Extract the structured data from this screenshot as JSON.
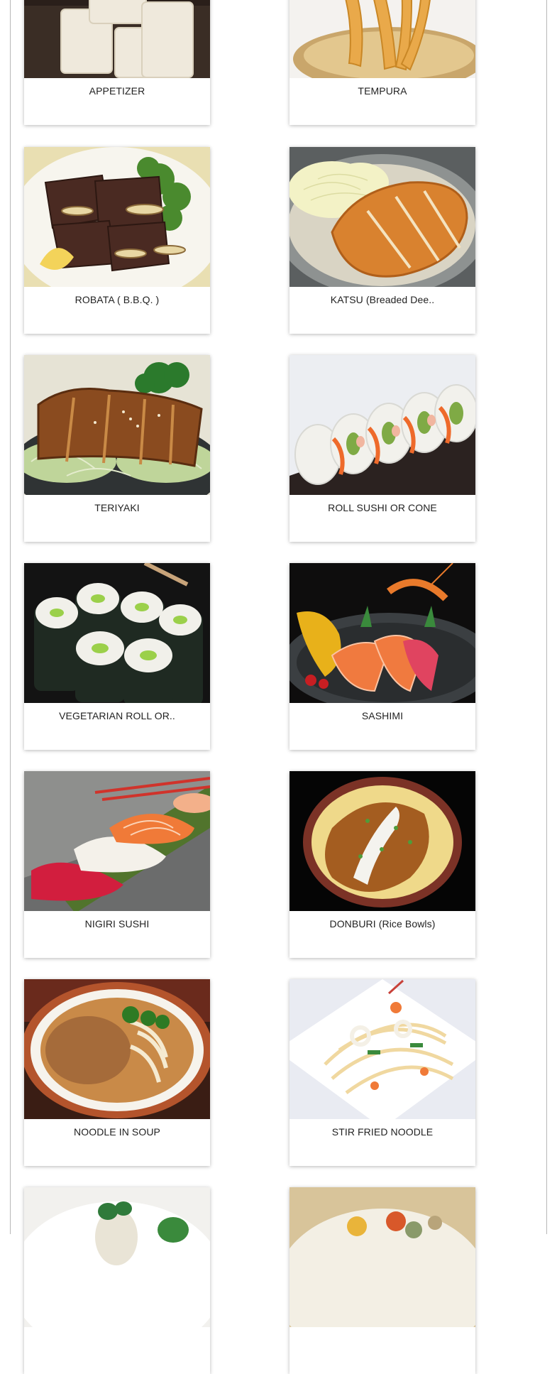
{
  "menu": {
    "categories": [
      {
        "label": "APPETIZER",
        "icon": "tofu-photo"
      },
      {
        "label": "TEMPURA",
        "icon": "tempura-photo"
      },
      {
        "label": "ROBATA ( B.B.Q. )",
        "icon": "bbq-ribs-photo"
      },
      {
        "label": "KATSU (Breaded Dee..",
        "icon": "katsu-photo"
      },
      {
        "label": "TERIYAKI",
        "icon": "teriyaki-photo"
      },
      {
        "label": "ROLL SUSHI OR CONE",
        "icon": "roll-sushi-photo"
      },
      {
        "label": "VEGETARIAN ROLL OR..",
        "icon": "veggie-roll-photo"
      },
      {
        "label": "SASHIMI",
        "icon": "sashimi-photo"
      },
      {
        "label": "NIGIRI SUSHI",
        "icon": "nigiri-photo"
      },
      {
        "label": "DONBURI (Rice Bowls)",
        "icon": "donburi-photo"
      },
      {
        "label": "NOODLE IN SOUP",
        "icon": "udon-photo"
      },
      {
        "label": "STIR FRIED NOODLE",
        "icon": "yakisoba-photo"
      },
      {
        "label": "",
        "icon": "sushi-roll-photo"
      },
      {
        "label": "",
        "icon": "bento-photo"
      }
    ]
  }
}
